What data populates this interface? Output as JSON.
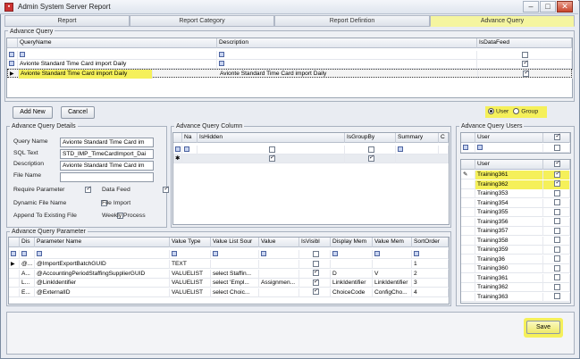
{
  "window": {
    "title": "Admin System Server Report",
    "min": "–",
    "max": "□",
    "close": "✕"
  },
  "tabs": [
    {
      "label": "Report"
    },
    {
      "label": "Report Category"
    },
    {
      "label": "Report Defintion"
    },
    {
      "label": "Advance Query"
    }
  ],
  "advance_query": {
    "title": "Advance Query",
    "columns": [
      "QueryName",
      "Description",
      "IsDataFeed"
    ],
    "rows": [
      {
        "name": "Avionte Standard Time Card import Daily",
        "description": "",
        "datafeed": true
      },
      {
        "name": "Avionte Standard Time Card import Daily",
        "description": "Avionte Standard Time Card import Daily",
        "datafeed": true
      }
    ]
  },
  "buttons": {
    "add_new": "Add New",
    "cancel": "Cancel",
    "save": "Save"
  },
  "mode": {
    "user": "User",
    "group": "Group",
    "selected": "User"
  },
  "details": {
    "title": "Advance Query Details",
    "query_name_label": "Query  Name",
    "query_name": "Avionte Standard Time Card im",
    "sql_text_label": "SQL Text",
    "sql_text": "STD_IMP_TimeCardImport_Dai",
    "description_label": "Description",
    "description": "Avionte Standard Time Card im",
    "file_name_label": "File Name",
    "file_name": "",
    "require_parameter": "Require Parameter",
    "data_feed": "Data Feed",
    "dynamic_file_name": "Dynamic File Name",
    "file_import": "File Import",
    "append_existing": "Append To Existing File",
    "weekly_process": "Weekly Process"
  },
  "column_panel": {
    "title": "Advance Query Column",
    "columns": [
      "Na",
      "IsHidden",
      "IsGroupBy",
      "Summary",
      "C"
    ]
  },
  "users_panel": {
    "title": "Advance Query Users",
    "filter_header": "User",
    "header": "User",
    "users": [
      {
        "name": "Training361",
        "checked": true
      },
      {
        "name": "Training362",
        "checked": true
      },
      {
        "name": "Training353",
        "checked": false
      },
      {
        "name": "Training354",
        "checked": false
      },
      {
        "name": "Training355",
        "checked": false
      },
      {
        "name": "Training356",
        "checked": false
      },
      {
        "name": "Training357",
        "checked": false
      },
      {
        "name": "Training358",
        "checked": false
      },
      {
        "name": "Training359",
        "checked": false
      },
      {
        "name": "Training36",
        "checked": false
      },
      {
        "name": "Training360",
        "checked": false
      },
      {
        "name": "Training361",
        "checked": false
      },
      {
        "name": "Training362",
        "checked": false
      },
      {
        "name": "Training363",
        "checked": false
      }
    ]
  },
  "parameter_panel": {
    "title": "Advance Query Parameter",
    "columns": [
      "Dis",
      "Parameter Name",
      "Value Type",
      "Value List Sour",
      "Value",
      "IsVisibl",
      "Display Mem",
      "Value Mem",
      "SortOrder"
    ],
    "rows": [
      {
        "dis": "@...",
        "name": "@ImportExportBatchGUID",
        "type": "TEXT",
        "source": "",
        "value": "",
        "visible": false,
        "display": "",
        "valuemem": "",
        "sort": "1"
      },
      {
        "dis": "A...",
        "name": "@AccountingPeriodStaffingSupplierGUID",
        "type": "VALUELIST",
        "source": "select  Staffin...",
        "value": "",
        "visible": true,
        "display": "D",
        "valuemem": "V",
        "sort": "2"
      },
      {
        "dis": "L...",
        "name": "@LinkIdentifier",
        "type": "VALUELIST",
        "source": "select  'Empl...",
        "value": "Assignmen...",
        "visible": true,
        "display": "LinkIdentifier",
        "valuemem": "LinkIdentifier",
        "sort": "3"
      },
      {
        "dis": "E...",
        "name": "@ExternalID",
        "type": "VALUELIST",
        "source": "select  Choic...",
        "value": "",
        "visible": true,
        "display": "ChoiceCode",
        "valuemem": "ConfigCho...",
        "sort": "4"
      }
    ]
  }
}
